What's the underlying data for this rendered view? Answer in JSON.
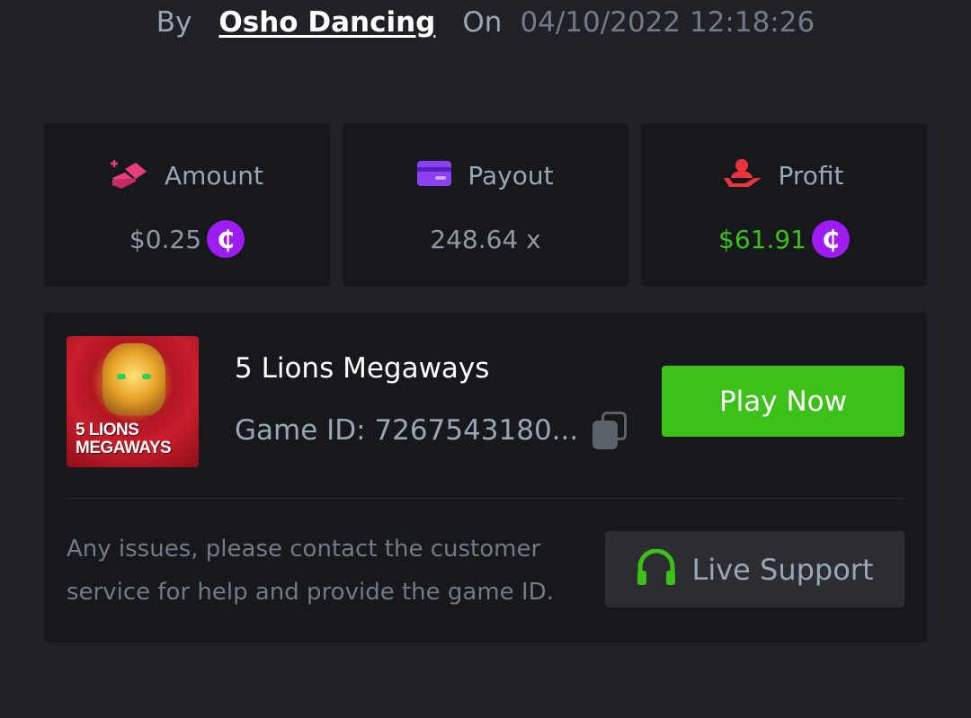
{
  "header": {
    "by_label": "By",
    "username": "Osho Dancing",
    "on_label": "On",
    "datetime": "04/10/2022 12:18:26"
  },
  "stats": [
    {
      "label": "Amount",
      "value": "$0.25",
      "icon": "coins-icon",
      "show_coin": true,
      "value_color": "#8e99a4"
    },
    {
      "label": "Payout",
      "value": "248.64 x",
      "icon": "card-icon",
      "show_coin": false,
      "value_color": "#8e99a4"
    },
    {
      "label": "Profit",
      "value": "$61.91",
      "icon": "hand-user-icon",
      "show_coin": true,
      "value_color": "#3bc117"
    }
  ],
  "coin_symbol": "₵",
  "game": {
    "thumbnail_text": [
      "5 LIONS",
      "MEGAWAYS"
    ],
    "title": "5 Lions Megaways",
    "id_label": "Game ID: 7267543180...",
    "play_button": "Play Now"
  },
  "help": {
    "text": "Any issues, please contact the customer service for help and provide the game ID.",
    "support_button": "Live Support"
  },
  "colors": {
    "accent_green": "#3bc117",
    "coin_purple": "#9c1cf2",
    "amount_pink": "#e83e7a",
    "payout_purple": "#8b3ff0",
    "profit_red": "#e8343c"
  }
}
